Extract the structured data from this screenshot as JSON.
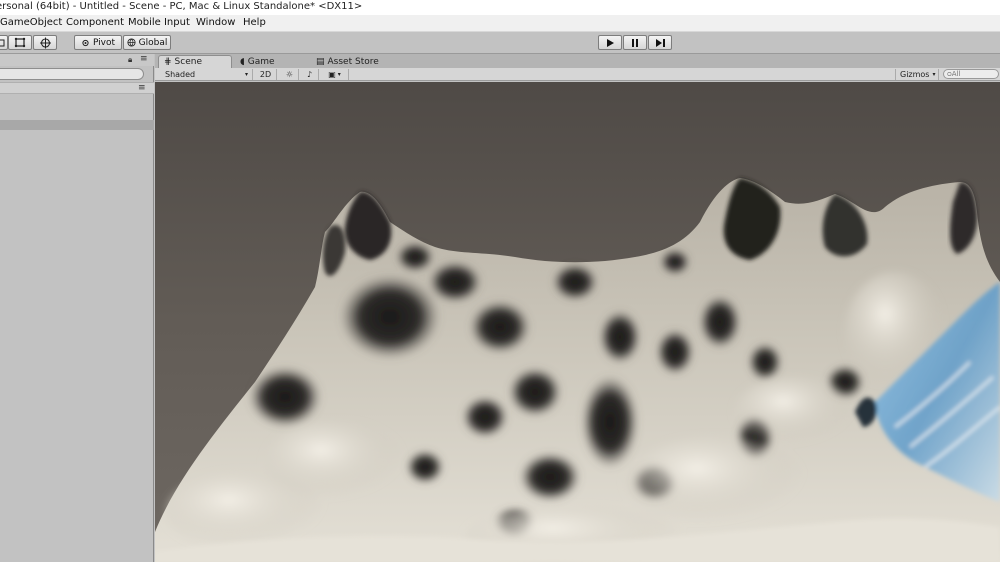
{
  "window": {
    "title": "ersonal (64bit) - Untitled - Scene - PC, Mac & Linux Standalone* <DX11>"
  },
  "menu": {
    "items": [
      "GameObject",
      "Component",
      "Mobile Input",
      "Window",
      "Help"
    ]
  },
  "toolbar": {
    "pivot_label": "Pivot",
    "global_label": "Global",
    "play_icon": "play-icon",
    "pause_icon": "pause-icon",
    "step_icon": "step-icon"
  },
  "tabs": {
    "scene": "Scene",
    "game": "Game",
    "asset_store": "Asset Store"
  },
  "scene_toolbar": {
    "shading_mode": "Shaded",
    "mode_2d": "2D",
    "gizmos_label": "Gizmos",
    "search_placeholder": "ᴑAll"
  },
  "colors": {
    "viewport_bg": "#5b5651",
    "panel_bg": "#c2c2c2",
    "terrain": "#d8d3c6",
    "water_tint": "#6fa8d6"
  }
}
